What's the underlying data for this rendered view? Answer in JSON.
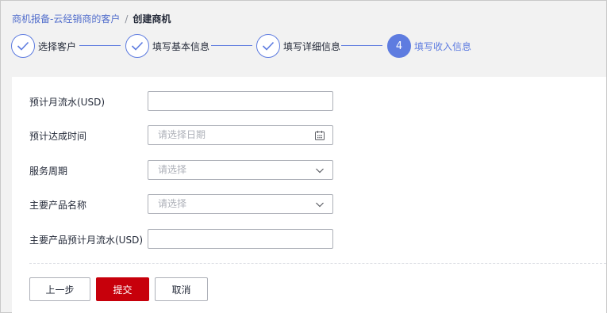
{
  "breadcrumb": {
    "parent": "商机报备-云经销商的客户",
    "separator": "/",
    "current": "创建商机"
  },
  "steps": [
    {
      "label": "选择客户",
      "status": "done"
    },
    {
      "label": "填写基本信息",
      "status": "done"
    },
    {
      "label": "填写详细信息",
      "status": "done"
    },
    {
      "label": "填写收入信息",
      "status": "active",
      "number": "4"
    }
  ],
  "form": {
    "monthly_flow": {
      "label": "预计月流水(USD)",
      "value": ""
    },
    "achieve_time": {
      "label": "预计达成时间",
      "placeholder": "请选择日期"
    },
    "service_period": {
      "label": "服务周期",
      "placeholder": "请选择"
    },
    "product_name": {
      "label": "主要产品名称",
      "placeholder": "请选择"
    },
    "product_monthly_flow": {
      "label": "主要产品预计月流水(USD)",
      "value": ""
    }
  },
  "buttons": {
    "prev": "上一步",
    "submit": "提交",
    "cancel": "取消"
  },
  "colors": {
    "primary": "#5e7ce0",
    "danger": "#c7000b",
    "link": "#526ecc"
  }
}
